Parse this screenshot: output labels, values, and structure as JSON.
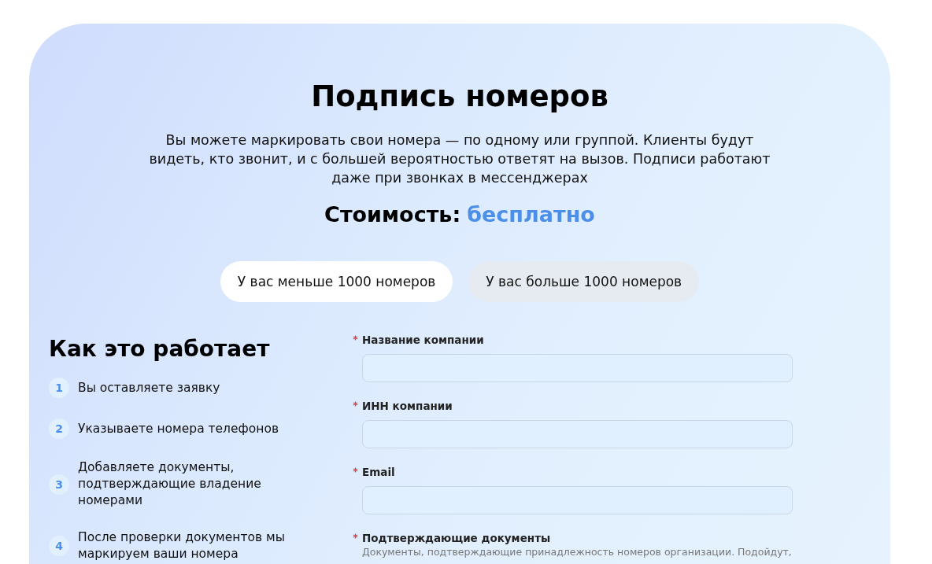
{
  "heading": "Подпись номеров",
  "description": "Вы можете маркировать свои номера — по одному или группой. Клиенты будут видеть, кто звонит, и с большей вероятностью ответят на вызов. Подписи работают даже при звонках в мессенджерах",
  "cost": {
    "label": "Стоимость:",
    "value": "бесплатно"
  },
  "tabs": [
    {
      "label": "У вас меньше 1000 номеров",
      "selected": true
    },
    {
      "label": "У вас больше 1000 номеров",
      "selected": false
    }
  ],
  "how_it_works": {
    "title": "Как это работает",
    "steps": [
      {
        "number": "1",
        "text": "Вы оставляете заявку"
      },
      {
        "number": "2",
        "text": "Указываете номера телефонов"
      },
      {
        "number": "3",
        "text": "Добавляете документы, подтверждающие владение номерами"
      },
      {
        "number": "4",
        "text": "После проверки документов мы маркируем ваши номера"
      }
    ]
  },
  "form": {
    "fields": [
      {
        "kind": "text",
        "label": "Название компании",
        "required": true
      },
      {
        "kind": "text",
        "label": "ИНН компании",
        "required": true
      },
      {
        "kind": "text",
        "label": "Email",
        "required": true
      },
      {
        "kind": "documents",
        "label": "Подтверждающие документы",
        "required": true,
        "description": "Документы, подтверждающие принадлежность номеров организации. Подойдут,"
      }
    ]
  }
}
